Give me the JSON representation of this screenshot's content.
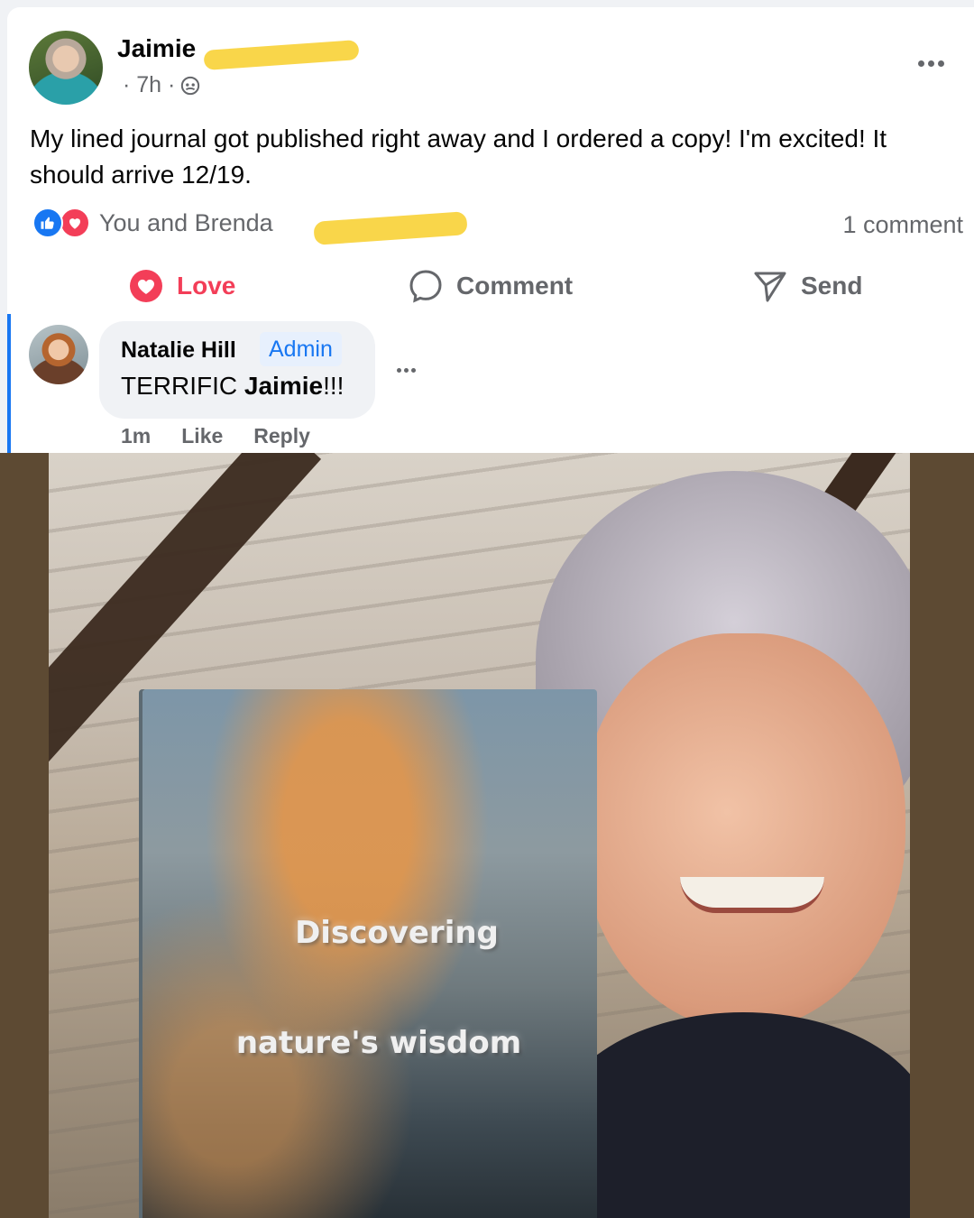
{
  "post": {
    "author": "Jaimie",
    "time": "· 7h ·",
    "privacy_icon": "friends-group-icon",
    "text": "My lined journal got published right away and I ordered a copy! I'm excited! It should arrive 12/19.",
    "reactions_text": "You and Brenda",
    "comment_count": "1 comment"
  },
  "actions": {
    "love": "Love",
    "comment": "Comment",
    "send": "Send"
  },
  "comment": {
    "author": "Natalie Hill",
    "badge": "Admin",
    "text_prefix": "TERRIFIC ",
    "text_name": "Jaimie",
    "text_suffix": "!!!",
    "time": "1m",
    "like": "Like",
    "reply": "Reply"
  },
  "photo": {
    "book_title_line1": "Discovering",
    "book_title_line2": "nature's wisdom"
  },
  "colors": {
    "accent": "#1877f2",
    "love": "#f33e58",
    "muted": "#65676b",
    "redaction": "#f9d64a"
  }
}
